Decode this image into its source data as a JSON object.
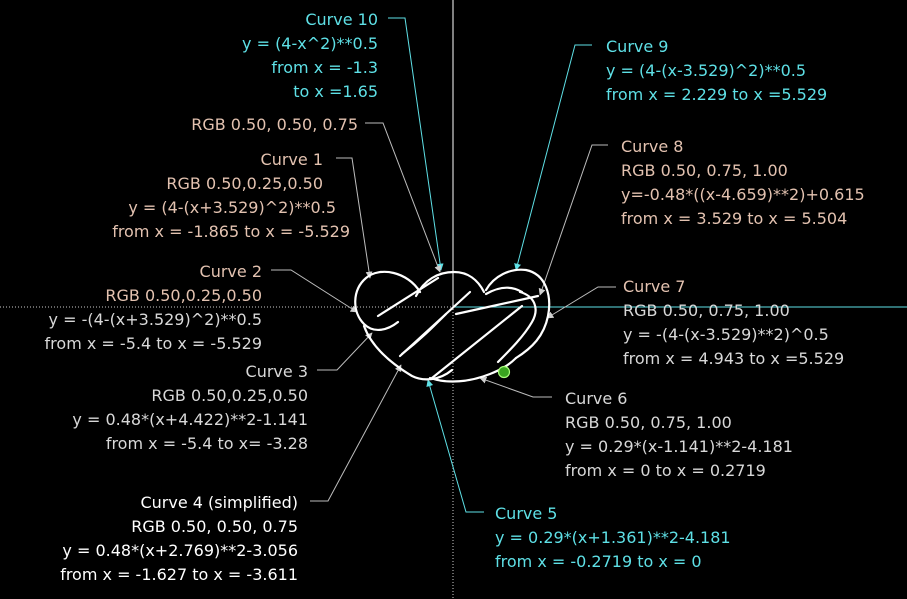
{
  "colors": {
    "background": "#000000",
    "cyan": "#5ee0e6",
    "tan": "#e3c2b0",
    "gray": "#d8d8d8",
    "white": "#ffffff",
    "axis": "#ffffff",
    "leader": "#bdbdbd",
    "dot_fill": "#3aa520",
    "dot_stroke": "#a8ff7a"
  },
  "labels": {
    "curve10": [
      "Curve 10",
      "y = (4-x^2)**0.5",
      "from x = -1.3",
      "to x =1.65"
    ],
    "curve10_color": "RGB 0.50, 0.50, 0.75",
    "curve9": [
      "Curve 9",
      "y = (4-(x-3.529)^2)**0.5",
      "from x = 2.229 to x =5.529"
    ],
    "curve1": [
      "Curve 1",
      "RGB 0.50,0.25,0.50",
      "y = (4-(x+3.529)^2)**0.5",
      "from x = -1.865 to x = -5.529"
    ],
    "curve8": [
      "Curve 8",
      "RGB 0.50, 0.75, 1.00",
      "y=-0.48*((x-4.659)**2)+0.615",
      "from x = 3.529 to x = 5.504"
    ],
    "curve2": [
      "Curve 2",
      "RGB 0.50,0.25,0.50",
      "y = -(4-(x+3.529)^2)**0.5",
      "from x = -5.4 to x = -5.529"
    ],
    "curve7": [
      "Curve 7",
      "RGB 0.50, 0.75, 1.00",
      "y = -(4-(x-3.529)**2)^0.5",
      "from x = 4.943 to x =5.529"
    ],
    "curve3": [
      "Curve 3",
      "RGB 0.50,0.25,0.50",
      "y = 0.48*(x+4.422)**2-1.141",
      "from x = -5.4 to x= -3.28"
    ],
    "curve6": [
      "Curve 6",
      "RGB 0.50, 0.75, 1.00",
      "y = 0.29*(x-1.141)**2-4.181",
      "from x = 0 to x = 0.2719"
    ],
    "curve4": [
      "Curve 4 (simplified)",
      "RGB 0.50, 0.50, 0.75",
      "y = 0.48*(x+2.769)**2-3.056",
      "from x = -1.627 to x = -3.611"
    ],
    "curve5": [
      "Curve 5",
      "y = 0.29*(x+1.361)**2-4.181",
      "from x = -0.2719 to x = 0"
    ]
  }
}
